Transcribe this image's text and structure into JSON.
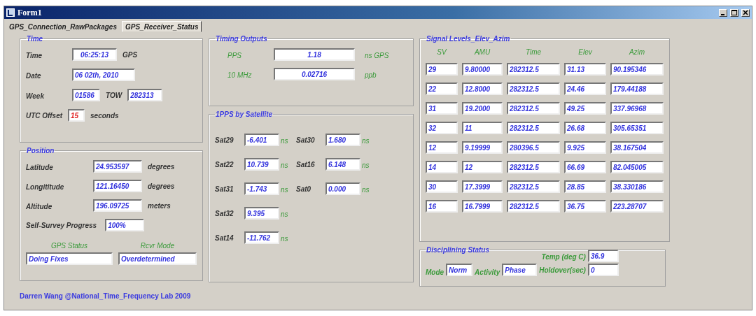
{
  "window": {
    "title": "Form1"
  },
  "tabs": [
    {
      "label": "GPS_Connection_RawPackages",
      "selected": false
    },
    {
      "label": "GPS_Receiver_Status",
      "selected": true
    }
  ],
  "time": {
    "title": "Time",
    "time_label": "Time",
    "time_value": "06:25:13",
    "time_unit": "GPS",
    "date_label": "Date",
    "date_value": "06 02th, 2010",
    "week_label": "Week",
    "week_value": "01586",
    "tow_label": "TOW",
    "tow_value": "282313",
    "utc_label": "UTC Offset",
    "utc_value": "15",
    "utc_unit": "seconds"
  },
  "position": {
    "title": "Position",
    "rows": [
      {
        "label": "Latitude",
        "value": "24.953597",
        "unit": "degrees"
      },
      {
        "label": "Longititude",
        "value": "121.16450",
        "unit": "degrees"
      },
      {
        "label": "Altitude",
        "value": "196.09725",
        "unit": "meters"
      }
    ],
    "survey_label": "Self-Survey Progress",
    "survey_value": "100%",
    "gps_status_label": "GPS Status",
    "gps_status_value": "Doing Fixes",
    "rcvr_mode_label": "Rcvr Mode",
    "rcvr_mode_value": "Overdetermined"
  },
  "timing_outputs": {
    "title": "Timing Outputs",
    "rows": [
      {
        "label": "PPS",
        "value": "1.18",
        "unit": "ns GPS"
      },
      {
        "label": "10 MHz",
        "value": "0.02716",
        "unit": "ppb"
      }
    ]
  },
  "pps_by_satellite": {
    "title": "1PPS by Satellite",
    "rows": [
      [
        {
          "label": "Sat29",
          "value": "-6.401",
          "unit": "ns"
        },
        {
          "label": "Sat30",
          "value": "1.680",
          "unit": "ns"
        }
      ],
      [
        {
          "label": "Sat22",
          "value": "10.739",
          "unit": "ns"
        },
        {
          "label": "Sat16",
          "value": "6.148",
          "unit": "ns"
        }
      ],
      [
        {
          "label": "Sat31",
          "value": "-1.743",
          "unit": "ns"
        },
        {
          "label": "Sat0",
          "value": "0.000",
          "unit": "ns"
        }
      ],
      [
        {
          "label": "Sat32",
          "value": "9.395",
          "unit": "ns"
        }
      ],
      [
        {
          "label": "Sat14",
          "value": "-11.762",
          "unit": "ns"
        }
      ]
    ]
  },
  "signal": {
    "title": "Signal Levels_Elev_Azim",
    "columns": [
      "SV",
      "AMU",
      "Time",
      "Elev",
      "Azim"
    ],
    "rows": [
      [
        "29",
        "9.80000",
        "282312.5",
        "31.13",
        "90.195346"
      ],
      [
        "22",
        "12.8000",
        "282312.5",
        "24.46",
        "179.44188"
      ],
      [
        "31",
        "19.2000",
        "282312.5",
        "49.25",
        "337.96968"
      ],
      [
        "32",
        "11",
        "282312.5",
        "26.68",
        "305.65351"
      ],
      [
        "12",
        "9.19999",
        "280396.5",
        "9.925",
        "38.167504"
      ],
      [
        "14",
        "12",
        "282312.5",
        "66.69",
        "82.045005"
      ],
      [
        "30",
        "17.3999",
        "282312.5",
        "28.85",
        "38.330186"
      ],
      [
        "16",
        "16.7999",
        "282312.5",
        "36.75",
        "223.28707"
      ]
    ]
  },
  "disciplining": {
    "title": "Disciplining Status",
    "mode_label": "Mode",
    "mode_value": "Norm",
    "activity_label": "Activity",
    "activity_value": "Phase",
    "temp_label": "Temp (deg C)",
    "temp_value": "36.9",
    "holdover_label": "Holdover(sec)",
    "holdover_value": "0"
  },
  "footer": "Darren Wang @National_Time_Frequency Lab 2009"
}
